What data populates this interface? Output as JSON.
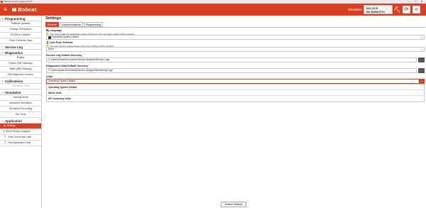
{
  "window": {
    "title": "Bobcat Service Analyzer 82.3",
    "min": "–",
    "max": "□",
    "close": "✕"
  },
  "header": {
    "menu_icon": "hamburger-icon",
    "logo_text": "Bobcat.",
    "sim_label": "Simulation",
    "sim_line1": "E42-J-H-R",
    "sim_line2": "SN: B4SM13724",
    "brand_color": "#d9401f"
  },
  "sidebar": {
    "sections": [
      {
        "label": "Programming",
        "items": [
          {
            "label": "Software Updates"
          },
          {
            "label": "Change SN/Options"
          },
          {
            "label": "EDI/ODU Updates"
          },
          {
            "label": "Clear Controller Data"
          }
        ]
      },
      {
        "label": "Service Log",
        "items": []
      },
      {
        "label": "Diagnostics",
        "items": [
          {
            "label": "Engine"
          },
          {
            "label": "Panels (ISB Gateway)"
          },
          {
            "label": "Watts (ISB Gateway)"
          },
          {
            "label": "EIB Diagnostic Screens"
          }
        ]
      },
      {
        "label": "Calibrations",
        "items": [
          {
            "label": "Interactive Tests",
            "grey": true
          }
        ]
      },
      {
        "label": "Simulation",
        "items": [
          {
            "label": "Training Mode"
          },
          {
            "label": "Advanced Simulation"
          },
          {
            "label": "Simulation Recording"
          },
          {
            "label": "Sim Tools"
          }
        ]
      },
      {
        "label": "Application",
        "items": [
          {
            "label": "Settings",
            "active": true,
            "icon": "⚙"
          },
          {
            "label": "About Service Analyzer",
            "icon": "ℹ"
          },
          {
            "label": "View Connection Help",
            "icon": "❓"
          },
          {
            "label": "View Application Help",
            "icon": "❓"
          }
        ]
      }
    ]
  },
  "main": {
    "title": "Settings",
    "tabs": [
      "General",
      "Communications",
      "Programming"
    ],
    "language_label": "Language",
    "language_note": "You must restart the application before changes to the Language setting will be applied",
    "language_value": "Operating System Default",
    "rule_label": "User Role Override",
    "rule_note": "You may need to restart before some role changes will be applied",
    "rule_value": "None",
    "svclog_label": "Service Log Default Directory",
    "svclog_value": "C:\\Users\\Admin\\Documents\\Service Analyzer\\Service Logs",
    "diag_label": "Diagnostics Data Default Directory",
    "diag_value": "C:\\Users\\Admin\\Documents\\Service Analyzer\\Monitoring Logs",
    "units_label": "Units",
    "units_value": "Operating System Default",
    "units_options": [
      "Operating System Default",
      "Metric Units",
      "US Customary Units"
    ],
    "browse_label": "...",
    "restore_label": "Restore Defaults"
  }
}
